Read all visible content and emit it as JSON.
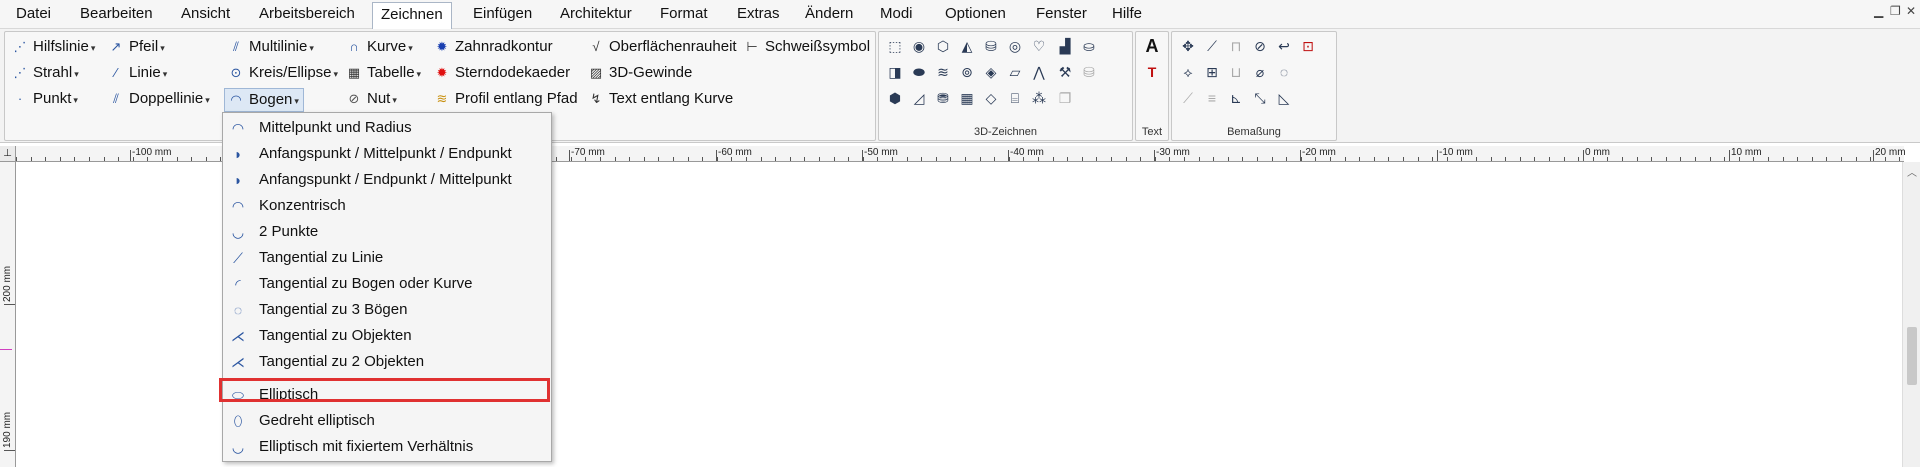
{
  "menu": {
    "items": [
      "Datei",
      "Bearbeiten",
      "Ansicht",
      "Arbeitsbereich",
      "Zeichnen",
      "Einfügen",
      "Architektur",
      "Format",
      "Extras",
      "Ändern",
      "Modi",
      "Optionen",
      "Fenster",
      "Hilfe"
    ],
    "active": "Zeichnen"
  },
  "ribbon": {
    "col1": [
      "Hilfslinie",
      "Strahl",
      "Punkt"
    ],
    "col2": [
      "Pfeil",
      "Linie",
      "Doppellinie"
    ],
    "col3": [
      "Multilinie",
      "Kreis/Ellipse",
      "Bogen"
    ],
    "col4": [
      "Kurve",
      "Tabelle",
      "Nut"
    ],
    "col5": [
      "Zahnradkontur",
      "Sterndodekaeder",
      "Profil entlang Pfad"
    ],
    "col6": [
      "Oberflächenrauheit",
      "3D-Gewinde",
      "Text entlang Kurve"
    ],
    "col7": [
      "Schweißsymbol"
    ],
    "groups": {
      "zeichnen3d": "3D-Zeichnen",
      "text": "Text",
      "bemassung": "Bemaßung"
    },
    "icons": {
      "col1": [
        "dotted-line-icon",
        "ray-icon",
        "point-icon"
      ],
      "col2": [
        "arrow-icon",
        "line-icon",
        "double-line-icon"
      ],
      "col3": [
        "multiline-icon",
        "circle-ellipse-icon",
        "arc-icon"
      ],
      "col4": [
        "curve-icon",
        "table-icon",
        "groove-icon"
      ],
      "col5": [
        "gear-icon",
        "star-dodecahedron-icon",
        "profile-path-icon"
      ],
      "col6": [
        "surface-roughness-icon",
        "thread-3d-icon",
        "text-curve-icon"
      ],
      "col7": [
        "weld-symbol-icon"
      ]
    }
  },
  "ruler": {
    "corner": "⊥",
    "labels": [
      "-100 mm",
      "-70 mm",
      "-60 mm",
      "-50 mm",
      "-40 mm",
      "-30 mm",
      "-20 mm",
      "-10 mm",
      "0 mm",
      "10 mm",
      "20 mm"
    ],
    "vlabels": [
      "200 mm",
      "190 mm"
    ]
  },
  "dropdown": {
    "items": [
      {
        "label": "Mittelpunkt und Radius",
        "icon": "arc-center-radius-icon"
      },
      {
        "label": "Anfangspunkt / Mittelpunkt / Endpunkt",
        "icon": "arc-start-center-end-icon"
      },
      {
        "label": "Anfangspunkt / Endpunkt / Mittelpunkt",
        "icon": "arc-start-end-center-icon"
      },
      {
        "label": "Konzentrisch",
        "icon": "arc-concentric-icon"
      },
      {
        "label": "2 Punkte",
        "icon": "arc-two-points-icon"
      },
      {
        "label": "Tangential zu Linie",
        "icon": "arc-tangent-line-icon"
      },
      {
        "label": "Tangential zu Bogen oder Kurve",
        "icon": "arc-tangent-arc-icon"
      },
      {
        "label": "Tangential zu 3 Bögen",
        "icon": "arc-tangent-three-arcs-icon"
      },
      {
        "label": "Tangential zu Objekten",
        "icon": "arc-tangent-objects-icon"
      },
      {
        "label": "Tangential zu 2 Objekten",
        "icon": "arc-tangent-two-objects-icon"
      },
      {
        "label": "Elliptisch",
        "icon": "arc-elliptic-icon"
      },
      {
        "label": "Gedreht elliptisch",
        "icon": "arc-rotated-elliptic-icon"
      },
      {
        "label": "Elliptisch mit fixiertem Verhältnis",
        "icon": "arc-elliptic-fixed-ratio-icon"
      }
    ],
    "highlighted": "Elliptisch"
  },
  "colors": {
    "highlight": "#e03131",
    "accent": "#2a55a0"
  }
}
